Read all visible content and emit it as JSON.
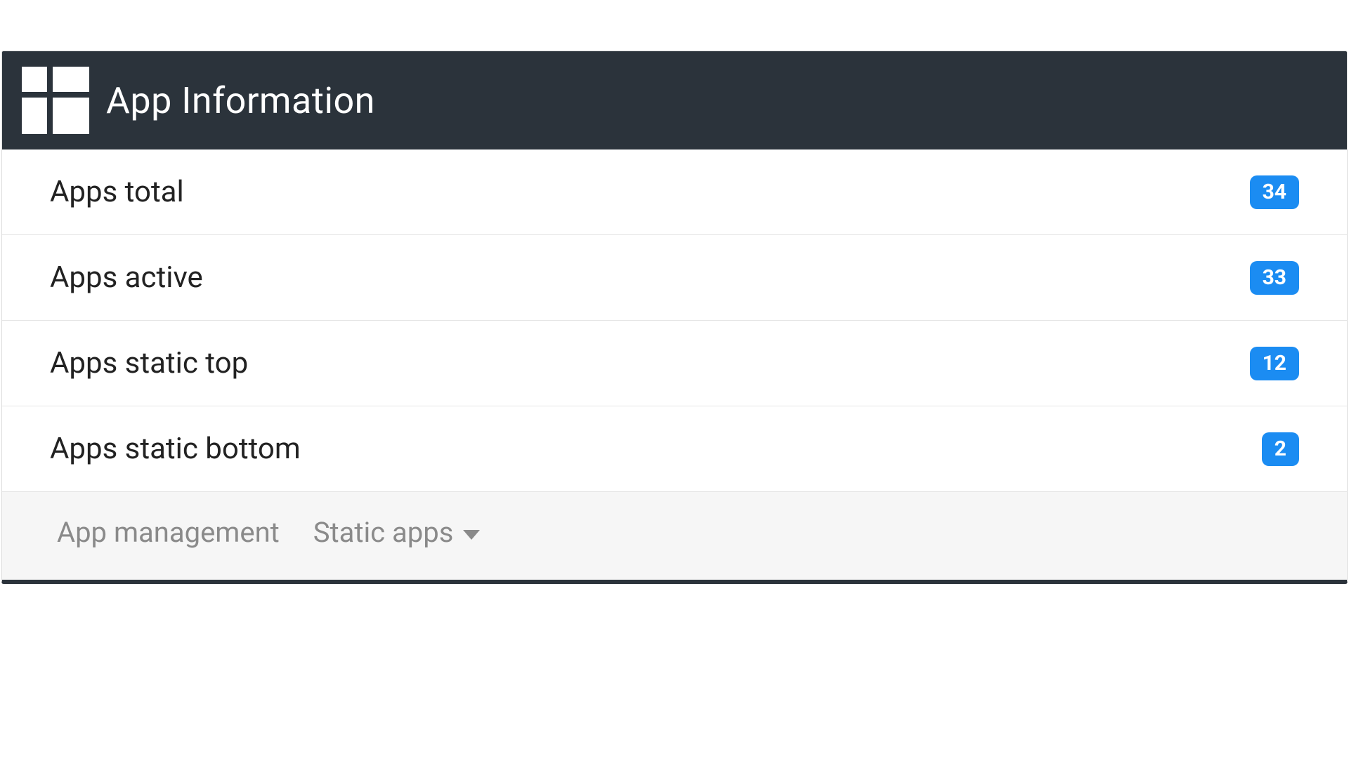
{
  "header": {
    "title": "App Information"
  },
  "stats": [
    {
      "label": "Apps total",
      "value": "34"
    },
    {
      "label": "Apps active",
      "value": "33"
    },
    {
      "label": "Apps static top",
      "value": "12"
    },
    {
      "label": "Apps static bottom",
      "value": "2"
    }
  ],
  "footer": {
    "management_label": "App management",
    "static_apps_label": "Static apps"
  }
}
